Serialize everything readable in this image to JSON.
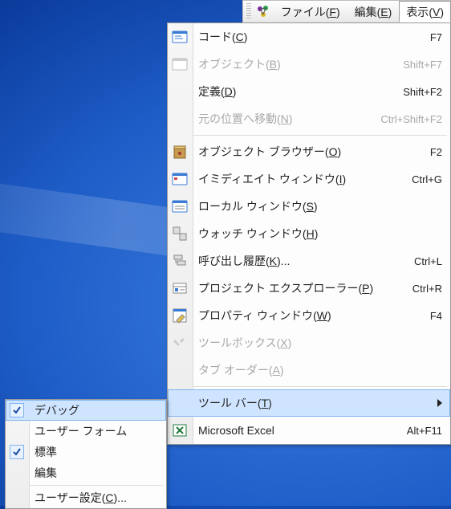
{
  "menubar": {
    "items": [
      {
        "label": "ファイル",
        "accesskey": "F"
      },
      {
        "label": "編集",
        "accesskey": "E"
      },
      {
        "label": "表示",
        "accesskey": "V"
      }
    ],
    "active_index": 2
  },
  "view_menu": {
    "items": [
      {
        "label": "コード",
        "accesskey": "C",
        "shortcut": "F7",
        "icon": "code-window-icon",
        "disabled": false,
        "ellipsis": false
      },
      {
        "label": "オブジェクト",
        "accesskey": "B",
        "shortcut": "Shift+F7",
        "icon": "object-window-icon",
        "disabled": true,
        "ellipsis": false
      },
      {
        "label": "定義",
        "accesskey": "D",
        "shortcut": "Shift+F2",
        "icon": null,
        "disabled": false,
        "ellipsis": false
      },
      {
        "label": "元の位置へ移動",
        "accesskey": "N",
        "shortcut": "Ctrl+Shift+F2",
        "icon": null,
        "disabled": true,
        "ellipsis": false
      },
      {
        "label": "オブジェクト ブラウザー",
        "accesskey": "O",
        "shortcut": "F2",
        "icon": "object-browser-icon",
        "disabled": false,
        "ellipsis": false
      },
      {
        "label": "イミディエイト ウィンドウ",
        "accesskey": "I",
        "shortcut": "Ctrl+G",
        "icon": "immediate-window-icon",
        "disabled": false,
        "ellipsis": false
      },
      {
        "label": "ローカル ウィンドウ",
        "accesskey": "S",
        "shortcut": "",
        "icon": "locals-window-icon",
        "disabled": false,
        "ellipsis": false
      },
      {
        "label": "ウォッチ ウィンドウ",
        "accesskey": "H",
        "shortcut": "",
        "icon": "watch-window-icon",
        "disabled": false,
        "ellipsis": false
      },
      {
        "label": "呼び出し履歴",
        "accesskey": "K",
        "shortcut": "Ctrl+L",
        "icon": "call-stack-icon",
        "disabled": false,
        "ellipsis": true
      },
      {
        "label": "プロジェクト エクスプローラー",
        "accesskey": "P",
        "shortcut": "Ctrl+R",
        "icon": "project-explorer-icon",
        "disabled": false,
        "ellipsis": false
      },
      {
        "label": "プロパティ ウィンドウ",
        "accesskey": "W",
        "shortcut": "F4",
        "icon": "properties-window-icon",
        "disabled": false,
        "ellipsis": false
      },
      {
        "label": "ツールボックス",
        "accesskey": "X",
        "shortcut": "",
        "icon": "toolbox-icon",
        "disabled": true,
        "ellipsis": false
      },
      {
        "label": "タブ オーダー",
        "accesskey": "A",
        "shortcut": "",
        "icon": null,
        "disabled": true,
        "ellipsis": false
      },
      {
        "label": "ツール バー",
        "accesskey": "T",
        "shortcut": "",
        "icon": null,
        "disabled": false,
        "submenu": true,
        "ellipsis": false
      },
      {
        "label": "Microsoft Excel",
        "accesskey": "",
        "shortcut": "Alt+F11",
        "icon": "excel-icon",
        "disabled": false,
        "ellipsis": false
      }
    ],
    "separators_after": [
      3,
      12
    ],
    "highlight_index": 13
  },
  "toolbars_submenu": {
    "items": [
      {
        "label": "デバッグ",
        "checked": true
      },
      {
        "label": "ユーザー フォーム",
        "checked": false
      },
      {
        "label": "標準",
        "checked": true
      },
      {
        "label": "編集",
        "checked": false
      },
      {
        "label": "ユーザー設定",
        "accesskey": "C",
        "ellipsis": true,
        "checked": false
      }
    ],
    "highlight_index": 0,
    "separator_after": 3
  }
}
